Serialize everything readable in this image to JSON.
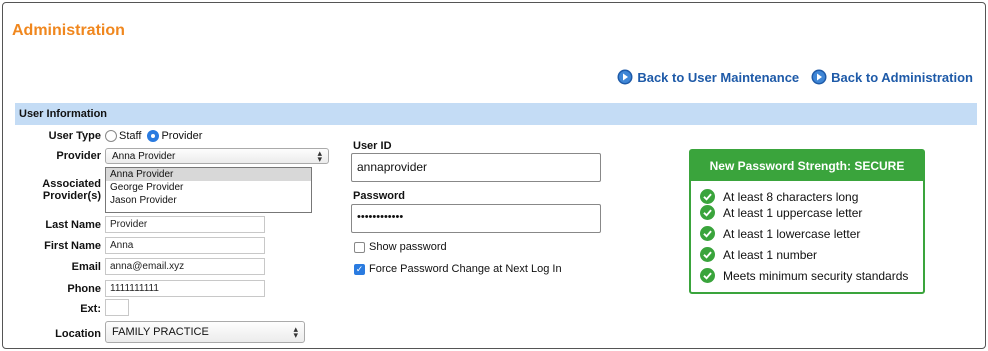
{
  "page": {
    "title": "Administration"
  },
  "nav": {
    "back_user_maintenance": "Back to User Maintenance",
    "back_administration": "Back to Administration"
  },
  "section": {
    "title": "User Information"
  },
  "form": {
    "user_type_label": "User Type",
    "user_type_options": [
      "Staff",
      "Provider"
    ],
    "user_type_selected": "Provider",
    "provider_label": "Provider",
    "provider_value": "Anna Provider",
    "associated_label_1": "Associated",
    "associated_label_2": "Provider(s)",
    "associated_options": [
      "Anna Provider",
      "George Provider",
      "Jason Provider"
    ],
    "associated_selected": "Anna Provider",
    "last_name_label": "Last Name",
    "last_name_value": "Provider",
    "first_name_label": "First Name",
    "first_name_value": "Anna",
    "email_label": "Email",
    "email_value": "anna@email.xyz",
    "phone_label": "Phone",
    "phone_value": "1111111111",
    "ext_label": "Ext:",
    "ext_value": "",
    "location_label": "Location",
    "location_value": "FAMILY PRACTICE",
    "user_id_label": "User ID",
    "user_id_value": "annaprovider",
    "password_label": "Password",
    "password_value": "••••••••••••",
    "show_password_label": "Show password",
    "show_password_checked": false,
    "force_change_label": "Force Password Change at Next Log In",
    "force_change_checked": true
  },
  "strength": {
    "header": "New Password Strength: SECURE",
    "rules": [
      "At least 8 characters long",
      "At least 1 uppercase letter",
      "At least 1 lowercase letter",
      "At least 1 number",
      "Meets minimum security standards"
    ]
  },
  "colors": {
    "title_orange": "#f0871e",
    "link_blue": "#1e5aa8",
    "section_blue": "#c4dcf5",
    "secure_green": "#3aa43c",
    "checkbox_blue": "#2a7be0"
  }
}
